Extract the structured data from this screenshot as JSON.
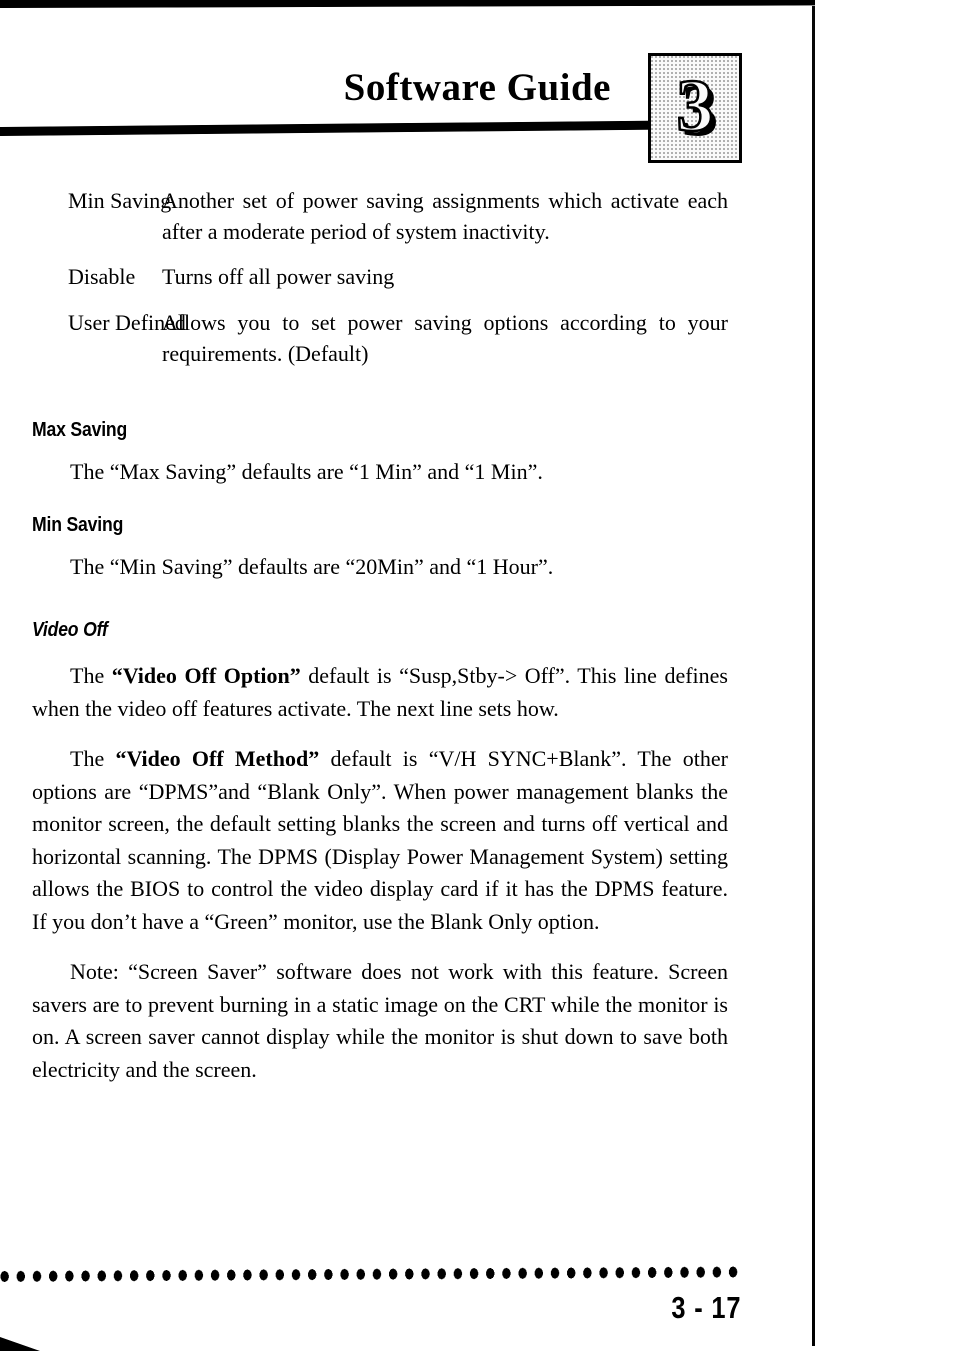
{
  "document": {
    "running_head": "Software Guide",
    "chapter_number": "3",
    "page_number": "3 - 17"
  },
  "definitions": [
    {
      "term": "Min Saving",
      "description": "Another set of power saving assignments which activate each after  a moderate period of system inactivity."
    },
    {
      "term": "Disable",
      "description": "Turns off all power saving"
    },
    {
      "term": "User Defined",
      "description": "Allows you to set power saving options  according to your requirements. (Default)"
    }
  ],
  "sections": [
    {
      "heading": "Max Saving",
      "style": "bold",
      "body": "The “Max Saving” defaults are “1 Min” and “1 Min”."
    },
    {
      "heading": "Min Saving",
      "style": "bold",
      "body": "The “Min Saving” defaults are “20Min” and “1 Hour”."
    },
    {
      "heading": "Video Off",
      "style": "bold-italic"
    }
  ],
  "video_off": {
    "para1": {
      "lead": "The ",
      "emphasis": "“Video Off Option”",
      "rest": " default is “Susp,Stby-> Off”. This line defines when the video off features activate. The next line sets how."
    },
    "para2": {
      "lead": "The ",
      "emphasis": "“Video Off Method”",
      "rest": " default is “V/H SYNC+Blank”. The other options are “DPMS”and “Blank Only”. When power management blanks the monitor screen, the default setting blanks the screen and turns off vertical and horizontal scanning. The DPMS (Display Power Management System) setting allows the BIOS to control the video display card if it has the DPMS feature. If you don’t have a “Green” monitor, use the Blank Only option."
    },
    "note": "Note: “Screen Saver” software does not work with this feature. Screen savers are to prevent burning in a static image on the CRT while the monitor is on. A screen saver cannot display while the monitor is shut down to save both electricity and the screen."
  },
  "colors": {
    "ink": "#000000",
    "paper": "#ffffff",
    "chapter_box_fill": "#f1f1f1"
  }
}
